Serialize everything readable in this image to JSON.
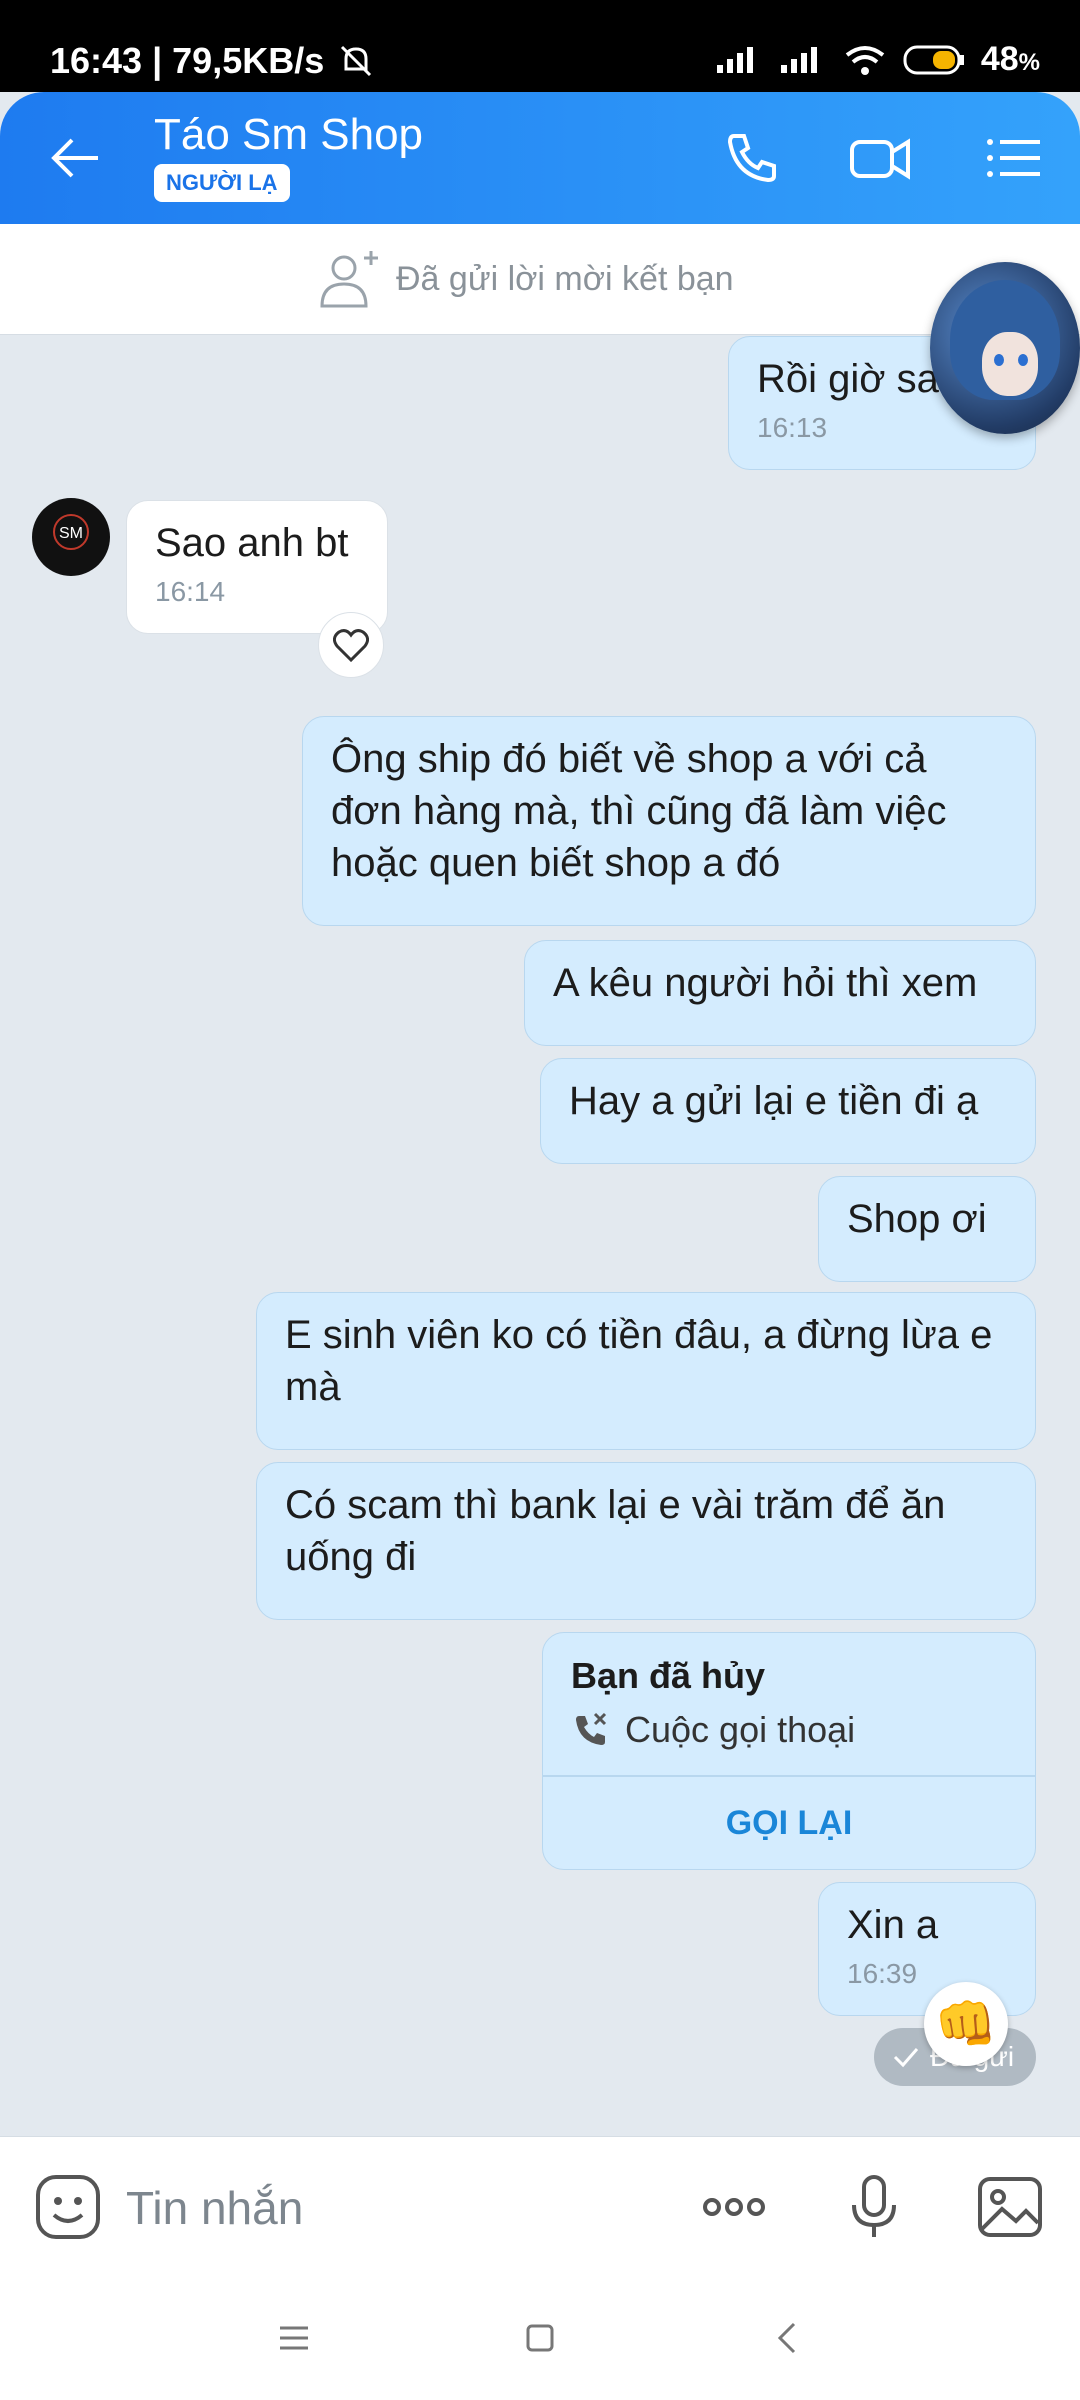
{
  "status": {
    "time_speed": "16:43 | 79,5KB/s",
    "battery": "48",
    "battery_pct": "%"
  },
  "header": {
    "title": "Táo Sm Shop",
    "badge": "NGƯỜI LẠ"
  },
  "friend_request": {
    "text": "Đã gửi lời mời kết bạn"
  },
  "messages": [
    {
      "text": "Rồi giờ sa",
      "time": "16:13"
    },
    {
      "text": "Sao anh bt",
      "time": "16:14"
    },
    {
      "text": "Ông ship đó biết về shop a với cả đơn hàng mà, thì cũng đã làm việc hoặc quen biết shop a đó"
    },
    {
      "text": "A kêu người hỏi thì xem"
    },
    {
      "text": "Hay a gửi lại e tiền đi ạ"
    },
    {
      "text": "Shop ơi"
    },
    {
      "text": "E sinh viên ko có tiền đâu, a đừng lừa e mà"
    },
    {
      "text": "Có scam thì bank lại e vài trăm để ăn uống đi"
    },
    {
      "text": "Xin a",
      "time": "16:39"
    }
  ],
  "call_card": {
    "title": "Bạn đã hủy",
    "subtitle": "Cuộc gọi thoại",
    "button": "GỌI LẠI"
  },
  "sent_status": "Đã gửi",
  "reaction_emoji": "👊",
  "composer": {
    "placeholder": "Tin nhắn"
  },
  "colors": {
    "header_start": "#1e7bf0",
    "header_end": "#34a2fb",
    "outgoing_bubble": "#d4ecfe",
    "accent": "#1a86d8"
  }
}
